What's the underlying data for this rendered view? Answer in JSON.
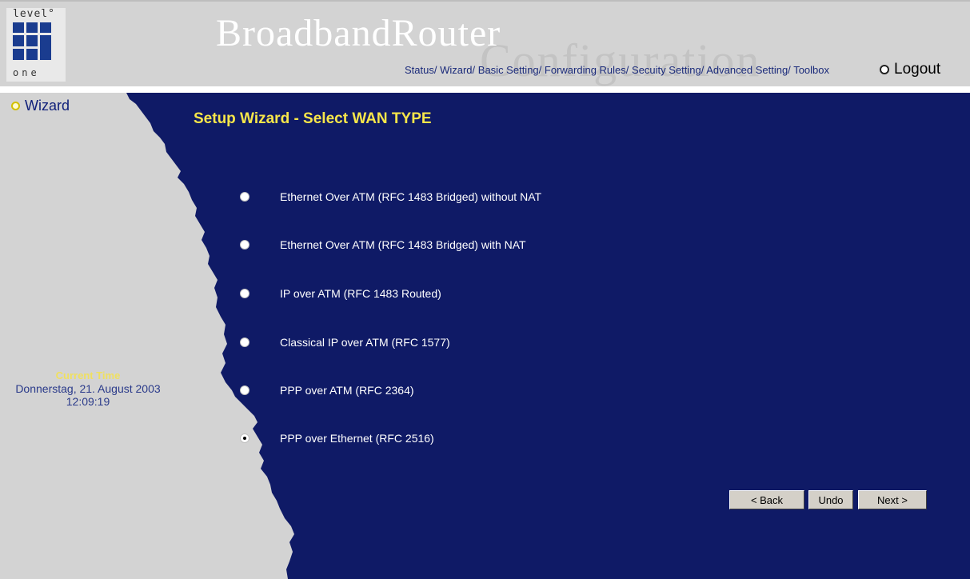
{
  "logo": {
    "top_text": "level°",
    "bottom_text": "one"
  },
  "brand": {
    "title": "BroadbandRouter",
    "subtitle": "Configuration"
  },
  "nav": {
    "items": [
      "Status/",
      "Wizard/",
      "Basic Setting/",
      "Forwarding Rules/",
      "Secuity Setting/",
      "Advanced Setting/",
      "Toolbox"
    ],
    "logout_label": "Logout"
  },
  "sidebar": {
    "wizard_label": "Wizard",
    "current_time_label": "Current Time",
    "date": "Donnerstag, 21. August 2003",
    "time": "12:09:19"
  },
  "main": {
    "title": "Setup Wizard - Select WAN TYPE",
    "options": [
      {
        "label": "Ethernet Over ATM (RFC 1483 Bridged) without NAT",
        "selected": false
      },
      {
        "label": "Ethernet Over ATM (RFC 1483 Bridged) with NAT",
        "selected": false
      },
      {
        "label": "IP over ATM (RFC 1483 Routed)",
        "selected": false
      },
      {
        "label": "Classical IP over ATM (RFC 1577)",
        "selected": false
      },
      {
        "label": "PPP over ATM (RFC 2364)",
        "selected": false
      },
      {
        "label": "PPP over Ethernet (RFC 2516)",
        "selected": true
      }
    ]
  },
  "buttons": {
    "back": "< Back",
    "undo": "Undo",
    "next": "Next >"
  },
  "colors": {
    "panel_blue": "#0f1a66",
    "title_yellow": "#f7e64a",
    "sidebar_grey": "#d3d3d3"
  }
}
